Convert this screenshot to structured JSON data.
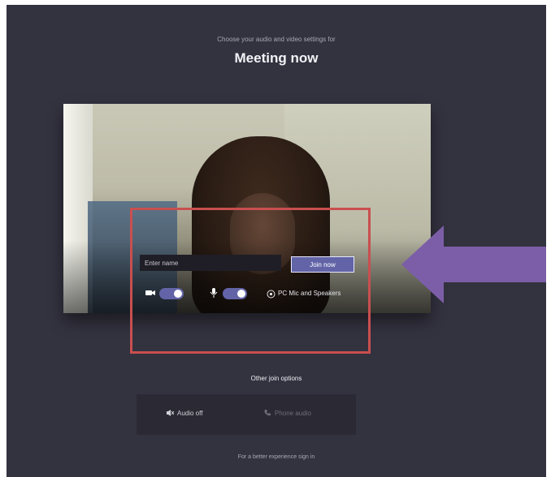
{
  "header": {
    "subtitle": "Choose your audio and video settings for",
    "title": "Meeting now"
  },
  "join": {
    "name_placeholder": "Enter name",
    "name_value": "",
    "join_label": "Join now"
  },
  "controls": {
    "camera_on": true,
    "mic_on": true,
    "device_label": "PC Mic and Speakers"
  },
  "other_options": {
    "title": "Other join options",
    "audio_off_label": "Audio off",
    "phone_audio_label": "Phone audio"
  },
  "footer": {
    "text": "For a better experience sign in"
  },
  "annotations": {
    "highlight_color": "#c94f4f",
    "arrow_color": "#7b5ea7"
  },
  "colors": {
    "background": "#33323f",
    "accent": "#6264a7"
  }
}
